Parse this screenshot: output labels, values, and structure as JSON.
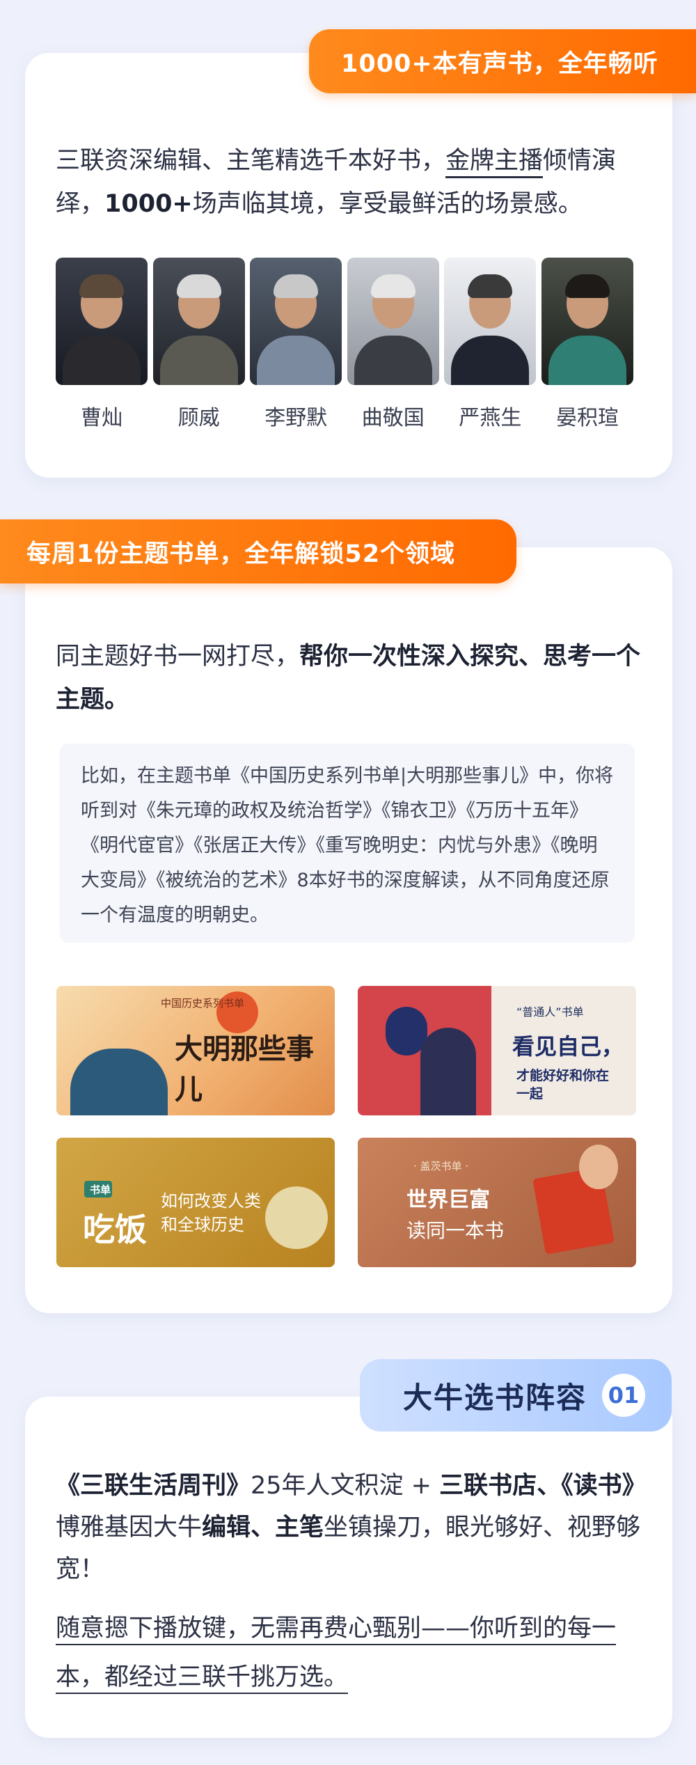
{
  "section1": {
    "tag": "1000+本有声书，全年畅听",
    "text_part1": "三联资深编辑、主笔精选千本好书，",
    "text_highlight": "金牌主播",
    "text_part2": "倾情演绎，",
    "text_bold": "1000+",
    "text_part3": "场声临其境，享受最鲜活的场景感。",
    "narrators": [
      "曹灿",
      "顾威",
      "李野默",
      "曲敬国",
      "严燕生",
      "晏积瑄"
    ]
  },
  "section2": {
    "tag": "每周1份主题书单，全年解锁52个领域",
    "intro_normal": "同主题好书一网打尽，",
    "intro_bold": "帮你一次性深入探究、思考一个主题。",
    "quote": "比如，在主题书单《中国历史系列书单|大明那些事儿》中，你将听到对《朱元璋的政权及统治哲学》《锦衣卫》《万历十五年》《明代宦官》《张居正大传》《重写晚明史：内忧与外患》《晚明大变局》《被统治的艺术》8本好书的深度解读，从不同角度还原一个有温度的明朝史。",
    "banners": [
      {
        "small": "中国历史系列书单",
        "title": "大明那些事儿"
      },
      {
        "small": "“普通人”书单",
        "title": "看见自己，",
        "sub": "才能好好和你在一起"
      },
      {
        "small": "书单",
        "title": "吃饭",
        "sub": "如何改变人类和全球历史"
      },
      {
        "small": "· 盖茨书单 ·",
        "title": "世界巨富",
        "sub": "读同一本书"
      }
    ]
  },
  "section3": {
    "tag": "大牛选书阵容",
    "tag_num": "01",
    "p1_b1": "《三联生活周刊》",
    "p1_n1": "25年人文积淀 + ",
    "p1_b2": "三联书店、《读书》",
    "p1_n2": "博雅基因大牛",
    "p1_b3": "编辑、主笔",
    "p1_n3": "坐镇操刀，眼光够好、视野够宽！",
    "p2": "随意摁下播放键，无需再费心甄别——你听到的每一本，都经过三联千挑万选。"
  }
}
